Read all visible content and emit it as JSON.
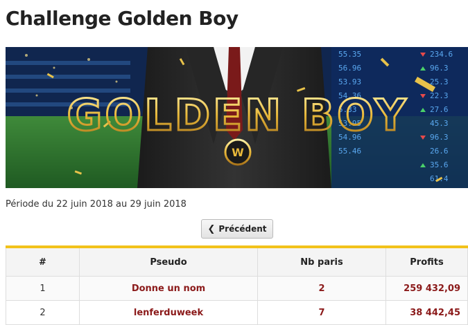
{
  "page": {
    "title": "Challenge Golden Boy"
  },
  "banner": {
    "logo_text": "GOLDEN BOY",
    "emblem_text": "W",
    "ticker_left": [
      "55.35",
      "56.96",
      "53.93",
      "54.36",
      "5.33",
      "53.95",
      "54.96",
      "55.46"
    ],
    "ticker_right": [
      "234.6",
      "96.3",
      "25.3",
      "22.3",
      "27.6",
      "45.3",
      "96.3",
      "26.6",
      "35.6",
      "61.4"
    ]
  },
  "period": {
    "text": "Période du 22 juin 2018 au 29 juin 2018"
  },
  "nav": {
    "prev_label": "Précédent",
    "prev_icon": "chevron-left-icon"
  },
  "table": {
    "headers": [
      "#",
      "Pseudo",
      "Nb paris",
      "Profits"
    ],
    "rows": [
      {
        "rank": "1",
        "pseudo": "Donne un nom",
        "bets": "2",
        "profit": "259 432,09"
      },
      {
        "rank": "2",
        "pseudo": "lenferduweek",
        "bets": "7",
        "profit": "38 442,45"
      }
    ]
  },
  "colors": {
    "accent": "#f2c21b",
    "link": "#8b1a1a",
    "header_bg": "#f4f4f4",
    "gold": "#e8b83a"
  }
}
